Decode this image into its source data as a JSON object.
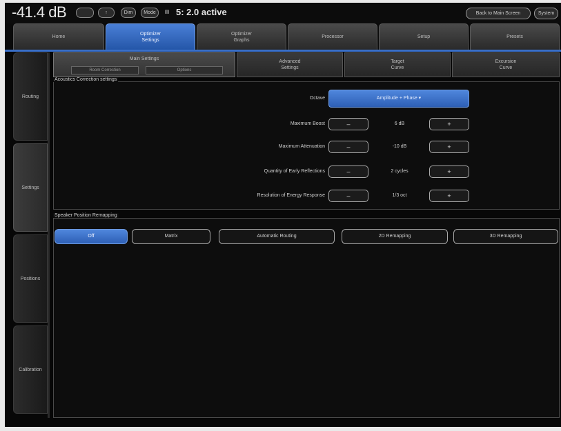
{
  "topbar": {
    "volume": "-41.4 dB",
    "icons": [
      {
        "name": "speaker-icon",
        "label": ""
      },
      {
        "name": "mute-icon",
        "label": "↑"
      },
      {
        "name": "dim-icon",
        "label": "Dim"
      },
      {
        "name": "mode-icon",
        "label": "Mode"
      },
      {
        "name": "input-icon",
        "label": "▤"
      }
    ],
    "status": "5: 2.0 active",
    "back_button": "Back to Main Screen",
    "system_button": "System"
  },
  "main_tabs": [
    {
      "name": "tab-home",
      "line1": "Home",
      "line2": ""
    },
    {
      "name": "tab-optimizer-settings",
      "line1": "Optimizer",
      "line2": "Settings",
      "active": true
    },
    {
      "name": "tab-optimizer-graphs",
      "line1": "Optimizer",
      "line2": "Graphs"
    },
    {
      "name": "tab-processor",
      "line1": "Processor",
      "line2": ""
    },
    {
      "name": "tab-setup",
      "line1": "Setup",
      "line2": ""
    },
    {
      "name": "tab-presets",
      "line1": "Presets",
      "line2": ""
    }
  ],
  "side_tabs": [
    {
      "name": "side-tab-routing",
      "label": "Routing"
    },
    {
      "name": "side-tab-settings",
      "label": "Settings",
      "active": true
    },
    {
      "name": "side-tab-positions",
      "label": "Positions"
    },
    {
      "name": "side-tab-calibration",
      "label": "Calibration"
    }
  ],
  "sub_tabs": [
    {
      "name": "subtab-main-settings",
      "line1": "Main Settings",
      "line2": "",
      "active": true
    },
    {
      "name": "subtab-advanced-settings",
      "line1": "Advanced",
      "line2": "Settings"
    },
    {
      "name": "subtab-target-curve",
      "line1": "Target",
      "line2": "Curve"
    },
    {
      "name": "subtab-excursion-curve",
      "line1": "Excursion",
      "line2": "Curve"
    }
  ],
  "main_settings_subs": [
    "Room Correction",
    "Options"
  ],
  "acoustics": {
    "title": "Acoustics Correction settings",
    "octave_label": "Octave",
    "octave_value": "Amplitude + Phase ▾",
    "rows": [
      {
        "label": "Maximum Boost",
        "value": "6 dB",
        "minus": "–",
        "plus": "+"
      },
      {
        "label": "Maximum Attenuation",
        "value": "-10 dB",
        "minus": "–",
        "plus": "+"
      },
      {
        "label": "Quantity of Early Reflections",
        "value": "2 cycles",
        "minus": "–",
        "plus": "+"
      },
      {
        "label": "Resolution of Energy Response",
        "value": "1/3 oct",
        "minus": "–",
        "plus": "+"
      }
    ]
  },
  "remapping": {
    "title": "Speaker Position Remapping",
    "options": [
      {
        "name": "remap-off-button",
        "label": "Off",
        "active": true
      },
      {
        "name": "remap-matrix-button",
        "label": "Matrix"
      },
      {
        "name": "remap-automatic-routing-button",
        "label": "Automatic Routing"
      },
      {
        "name": "remap-2d-button",
        "label": "2D Remapping"
      },
      {
        "name": "remap-3d-button",
        "label": "3D Remapping"
      }
    ]
  },
  "colors": {
    "accent": "#3a6fc8",
    "background": "#070707",
    "inactive_tab": "#2a2a2a"
  }
}
